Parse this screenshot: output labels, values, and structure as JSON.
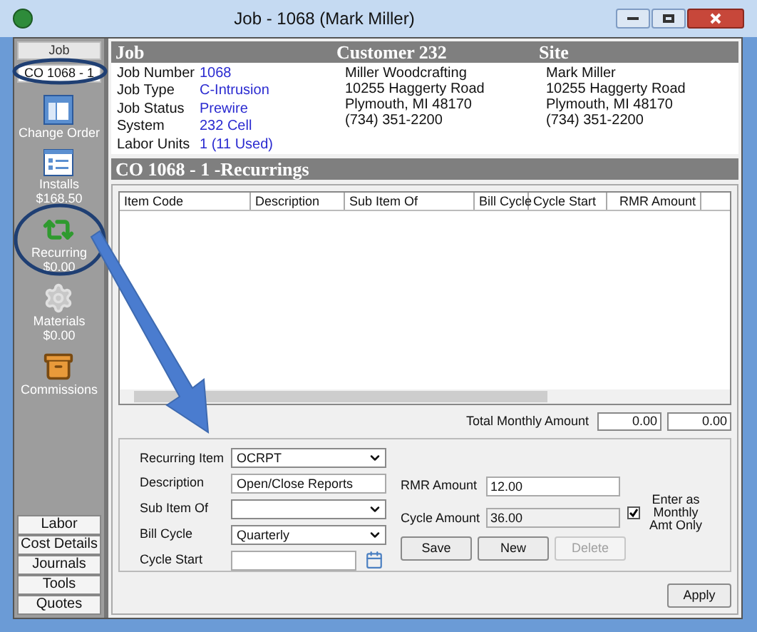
{
  "window": {
    "title": "Job - 1068 (Mark Miller)"
  },
  "sidebar": {
    "tabs": [
      {
        "label": "Job",
        "selected": false
      },
      {
        "label": "CO 1068 - 1",
        "selected": true
      }
    ],
    "items": [
      {
        "kind": "change_order",
        "label": "Change Order"
      },
      {
        "kind": "installs",
        "label": "Installs",
        "amount": "$168.50"
      },
      {
        "kind": "recurring",
        "label": "Recurring",
        "amount": "$0.00"
      },
      {
        "kind": "materials",
        "label": "Materials",
        "amount": "$0.00"
      },
      {
        "kind": "commissions",
        "label": "Commissions"
      }
    ],
    "buttons": [
      "Labor",
      "Cost Details",
      "Journals",
      "Tools",
      "Quotes"
    ]
  },
  "header": {
    "job": {
      "title": "Job",
      "fields": [
        {
          "label": "Job Number",
          "value": "1068"
        },
        {
          "label": "Job Type",
          "value": "C-Intrusion"
        },
        {
          "label": "Job Status",
          "value": "Prewire"
        },
        {
          "label": "System",
          "value": "232 Cell"
        },
        {
          "label": "Labor Units",
          "value": "1 (11 Used)"
        }
      ]
    },
    "customer": {
      "title": "Customer 232",
      "lines": [
        "Miller Woodcrafting",
        "10255 Haggerty Road",
        "Plymouth, MI  48170",
        "(734) 351-2200"
      ]
    },
    "site": {
      "title": "Site",
      "lines": [
        "Mark Miller",
        "10255 Haggerty Road",
        "Plymouth, MI  48170",
        "(734) 351-2200"
      ]
    }
  },
  "section_title": "CO 1068 - 1 -Recurrings",
  "table": {
    "columns": [
      "Item Code",
      "Description",
      "Sub Item Of",
      "Bill Cycle",
      "Cycle Start",
      "RMR Amount"
    ]
  },
  "total": {
    "label": "Total Monthly Amount",
    "values": [
      "0.00",
      "0.00"
    ]
  },
  "form": {
    "fields": [
      {
        "kind": "dropdown",
        "label": "Recurring Item",
        "value": "OCRPT"
      },
      {
        "kind": "text",
        "label": "Description",
        "value": "Open/Close Reports"
      },
      {
        "kind": "dropdown",
        "label": "Sub Item Of"
      },
      {
        "kind": "dropdown",
        "label": "Bill Cycle",
        "value": "Quarterly"
      },
      {
        "kind": "date",
        "label": "Cycle Start"
      }
    ],
    "amounts": [
      {
        "label": "RMR Amount",
        "value": "12.00",
        "disabled": false
      },
      {
        "label": "Cycle Amount",
        "value": "36.00",
        "disabled": true
      }
    ],
    "checkbox": {
      "label": "Enter as Monthly Amt Only",
      "checked": true
    },
    "buttons": [
      {
        "label": "Save",
        "disabled": false
      },
      {
        "label": "New",
        "disabled": false
      },
      {
        "label": "Delete",
        "disabled": true
      }
    ]
  },
  "apply_button": "Apply"
}
